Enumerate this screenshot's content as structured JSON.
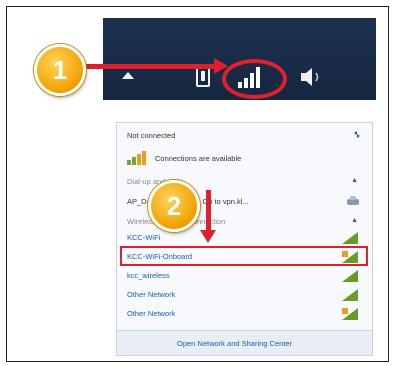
{
  "steps": {
    "one": "1",
    "two": "2"
  },
  "panel": {
    "status": "Not connected",
    "connections": "Connections are available",
    "dialup_header": "Dial-up and VPN",
    "vpn_item": "AP_Desktop_na_res - Go to vpn.kl...",
    "wireless_header": "Wireless Network Connection",
    "networks": [
      {
        "label": "KCC-WiFi"
      },
      {
        "label": "KCC-WiFi-Onboard"
      },
      {
        "label": "kcc_wireless"
      },
      {
        "label": "Other Network"
      },
      {
        "label": "Other Network"
      }
    ],
    "footer_link": "Open Network and Sharing Center"
  },
  "colors": {
    "annotation_red": "#e0202c",
    "badge_orange": "#f0a000",
    "taskbar": "#1c3050",
    "link_blue": "#1a5fb4"
  },
  "icons": {
    "tray": [
      "show-hidden-icons-arrow",
      "device-icon",
      "wifi-signal-icon",
      "speaker-icon"
    ]
  }
}
